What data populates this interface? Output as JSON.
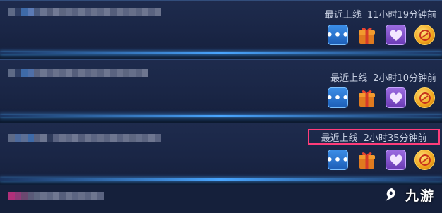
{
  "rows": [
    {
      "status_label": "最近上线",
      "status_time": "11小时19分钟前"
    },
    {
      "status_label": "最近上线",
      "status_time": "2小时10分钟前"
    },
    {
      "status_label": "最近上线",
      "status_time": "2小时35分钟前"
    }
  ],
  "icons": [
    "chat-icon",
    "gift-icon",
    "heart-icon",
    "coin-icon"
  ],
  "chat_glyph": "•••",
  "highlight_color": "#ff3d7a",
  "watermark": {
    "text": "九游"
  }
}
